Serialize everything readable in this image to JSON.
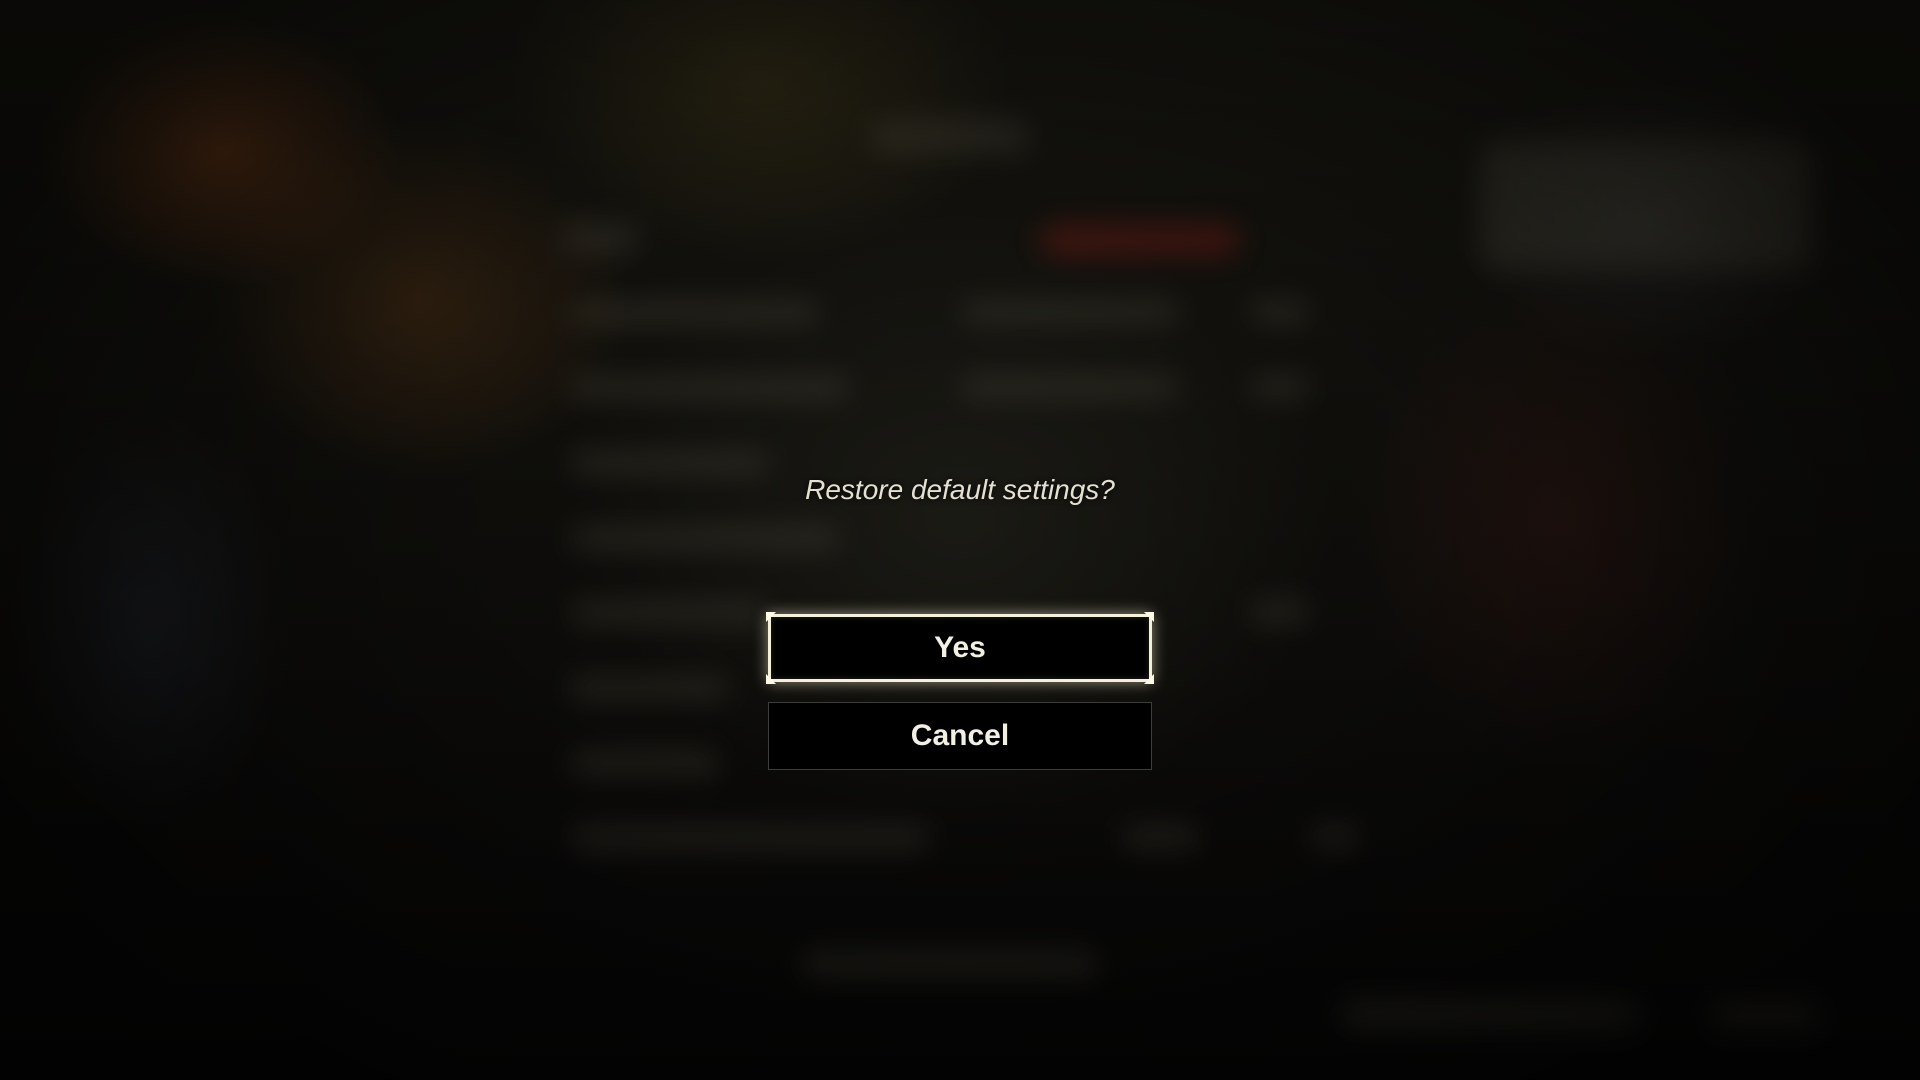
{
  "dialog": {
    "prompt": "Restore default settings?",
    "options": [
      {
        "label": "Yes",
        "selected": true
      },
      {
        "label": "Cancel",
        "selected": false
      }
    ]
  },
  "colors": {
    "background": "#000000",
    "prompt_text": "#e4e0d2",
    "button_text": "#f2efe4",
    "selected_border": "#f4f0dc",
    "unselected_border": "#3c3c38"
  }
}
